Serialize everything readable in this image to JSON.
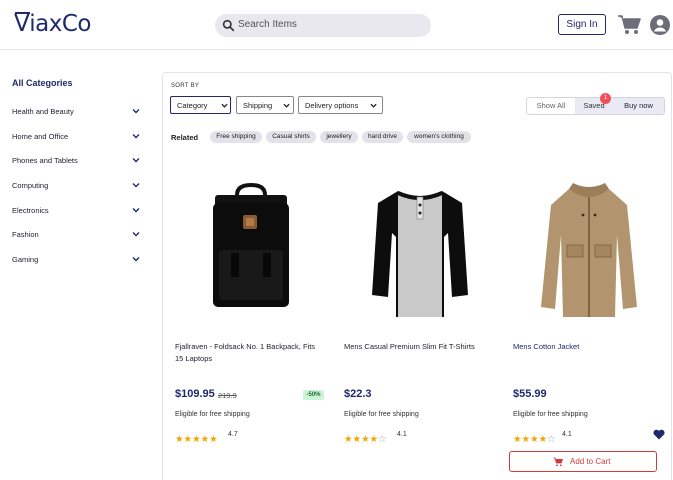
{
  "header": {
    "logo_text": "ViaxCo",
    "search_placeholder": "Search Items",
    "signin_label": "Sign In",
    "cart_icon": "cart-icon",
    "user_icon": "user-icon"
  },
  "sidebar": {
    "title": "All Categories",
    "items": [
      {
        "label": "Health and Beauty"
      },
      {
        "label": "Home and Office"
      },
      {
        "label": "Phones and Tablets"
      },
      {
        "label": "Computing"
      },
      {
        "label": "Electronics"
      },
      {
        "label": "Fashion"
      },
      {
        "label": "Gaming"
      }
    ]
  },
  "toolbar": {
    "sort_by": "SORT BY",
    "filters": [
      {
        "label": "Category"
      },
      {
        "label": "Shipping"
      },
      {
        "label": "Delivery options"
      }
    ],
    "view_options": {
      "show_all": "Show All",
      "saved": "Saved",
      "saved_count": "1",
      "buy_now": "Buy now"
    }
  },
  "related": {
    "label": "Related",
    "chips": [
      "Free shipping",
      "Casual shirts",
      "jewellery",
      "hard drive",
      "women's clothing"
    ]
  },
  "products": [
    {
      "name": "Fjallraven - Foldsack No. 1 Backpack, Fits 15 Laptops",
      "price": "$109.95",
      "old_price": "219.9",
      "discount": "-50%",
      "shipping": "Eligible for free shipping",
      "stars": 5,
      "rating": "4.7"
    },
    {
      "name": "Mens Casual Premium Slim Fit T-Shirts",
      "price": "$22.3",
      "shipping": "Eligible for free shipping",
      "stars": 4,
      "rating": "4.1"
    },
    {
      "name": "Mens Cotton Jacket",
      "price": "$55.99",
      "shipping": "Eligible for free shipping",
      "stars": 4,
      "rating": "4.1",
      "saved": true,
      "add_to_cart": "Add to Cart"
    }
  ],
  "colors": {
    "brand": "#1e2a6b",
    "accent_red": "#d23b3b",
    "badge": "#f04f5a",
    "star": "#f0a500"
  }
}
